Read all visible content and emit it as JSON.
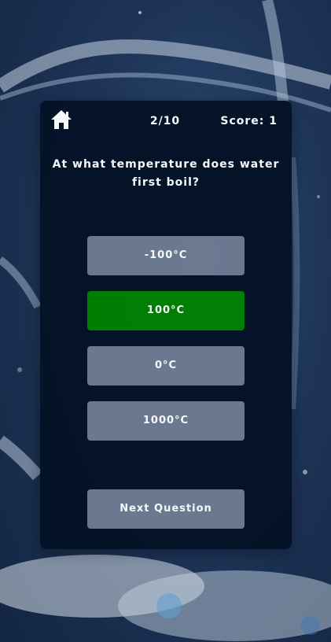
{
  "header": {
    "home_icon": "home-icon",
    "progress": "2/10",
    "score": "Score: 1"
  },
  "question": {
    "text": "At what temperature does water first boil?"
  },
  "answers": [
    {
      "label": "-100°C",
      "state": "default"
    },
    {
      "label": "100°C",
      "state": "correct"
    },
    {
      "label": "0°C",
      "state": "default"
    },
    {
      "label": "1000°C",
      "state": "default"
    }
  ],
  "next_button": {
    "label": "Next Question"
  },
  "colors": {
    "card_background": "#041226",
    "answer_button": "#6d7b92",
    "correct_answer": "#008000",
    "text": "#ffffff"
  }
}
